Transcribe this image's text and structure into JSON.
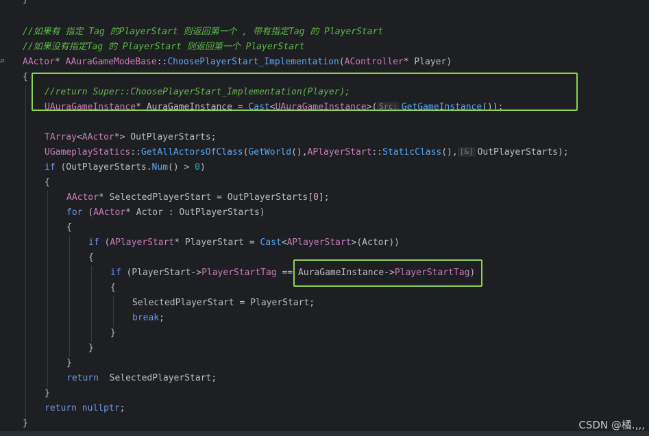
{
  "editor": {
    "top_fragment": "}",
    "lines": {
      "c1": "//如果有 指定 Tag 的PlayerStart 则返回第一个 , 带有指定Tag 的 PlayerStart",
      "c2": "//如果没有指定Tag 的 PlayerStart 则返回第一个 PlayerStart",
      "sig_type": "AActor",
      "sig_star": "* ",
      "sig_class": "AAuraGameModeBase",
      "sig_sep": "::",
      "sig_fn": "ChoosePlayerStart_Implementation",
      "sig_open": "(",
      "sig_ptype": "AController",
      "sig_rest": "* Player)",
      "brace_open": "{",
      "l_return_comment": "//return Super::ChoosePlayerStart_Implementation(Player);",
      "l_gi_type": "UAuraGameInstance",
      "l_gi_mid": "* ",
      "l_gi_var": "AuraGameInstance",
      "l_gi_eq": " = ",
      "l_gi_cast": "Cast",
      "l_gi_lt": "<",
      "l_gi_t2": "UAuraGameInstance",
      "l_gi_gt": ">(",
      "l_gi_hint": "Src:",
      "l_gi_fn": "GetGameInstance",
      "l_gi_end": "());",
      "l_arr_t": "TArray",
      "l_arr_lt": "<",
      "l_arr_t2": "AActor",
      "l_arr_rest": "*> OutPlayerStarts;",
      "l_ugs": "UGameplayStatics",
      "l_ugs_sep": "::",
      "l_ugs_fn": "GetAllActorsOfClass",
      "l_ugs_p": "(",
      "l_ugs_gw": "GetWorld",
      "l_ugs_p2": "(),",
      "l_ugs_aps": "APlayerStart",
      "l_ugs_sep2": "::",
      "l_ugs_sc": "StaticClass",
      "l_ugs_p3": "(),",
      "l_ugs_hint": "[&]",
      "l_ugs_end": "OutPlayerStarts);",
      "l_if1_kw": "if",
      "l_if1_a": " (OutPlayerStarts.",
      "l_if1_num": "Num",
      "l_if1_b": "() > ",
      "l_if1_zero": "0",
      "l_if1_c": ")",
      "brace2": "{",
      "l_sel_t": "AActor",
      "l_sel_rest": "* SelectedPlayerStart = OutPlayerStarts[",
      "l_sel_idx": "0",
      "l_sel_end": "];",
      "l_for_kw": "for",
      "l_for_a": " (",
      "l_for_t": "AActor",
      "l_for_rest": "* Actor : OutPlayerStarts)",
      "brace3": "{",
      "l_if2_kw": "if",
      "l_if2_a": " (",
      "l_if2_t": "APlayerStart",
      "l_if2_b": "* PlayerStart = ",
      "l_if2_cast": "Cast",
      "l_if2_lt": "<",
      "l_if2_t2": "APlayerStart",
      "l_if2_end": ">(Actor))",
      "brace4": "{",
      "l_if3_kw": "if",
      "l_if3_a": " (PlayerStart->",
      "l_if3_m": "PlayerStartTag",
      "l_if3_b": " == AuraGameInstance->",
      "l_if3_m2": "PlayerStartTag",
      "l_if3_end": ")",
      "brace5": "{",
      "l_assign": "SelectedPlayerStart = PlayerStart;",
      "l_break": "break",
      "l_break_semi": ";",
      "brace5c": "}",
      "brace4c": "}",
      "brace3c": "}",
      "l_ret_kw": "return",
      "l_ret_rest": "  SelectedPlayerStart;",
      "brace2c": "}",
      "l_ret2_kw": "return",
      "l_ret2_sp": " ",
      "l_ret2_null": "nullptr",
      "l_ret2_semi": ";",
      "brace_close": "}"
    }
  },
  "watermark": "CSDN @橘.,,,",
  "colors": {
    "background": "#1e1f22",
    "comment": "#5fb84a",
    "highlight_box": "#8fd14f"
  }
}
